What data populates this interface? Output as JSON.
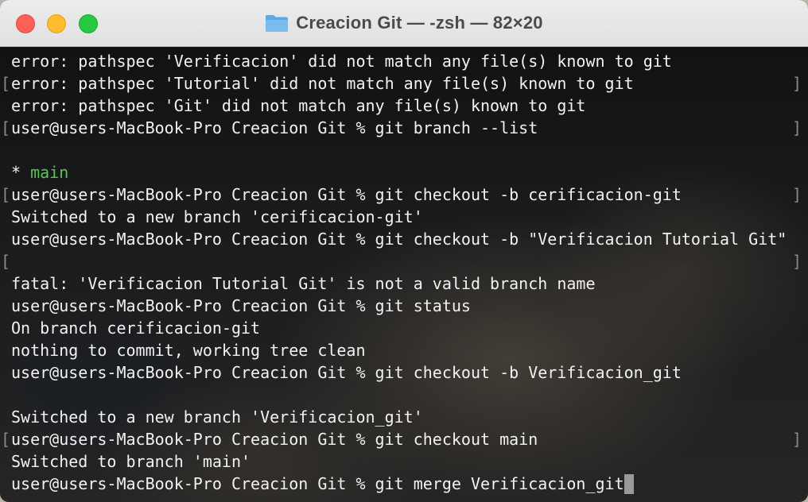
{
  "window": {
    "title": "Creacion Git — -zsh — 82×20",
    "title_icon": "folder-icon"
  },
  "terminal": {
    "lines": [
      {
        "text": "error: pathspec 'Verificacion' did not match any file(s) known to git",
        "left_bracket": "",
        "right_bracket": ""
      },
      {
        "text": "error: pathspec 'Tutorial' did not match any file(s) known to git",
        "left_bracket": "[",
        "right_bracket": "]"
      },
      {
        "text": "error: pathspec 'Git' did not match any file(s) known to git",
        "left_bracket": "",
        "right_bracket": ""
      },
      {
        "text": "user@users-MacBook-Pro Creacion Git % git branch --list",
        "left_bracket": "[",
        "right_bracket": "]"
      },
      {
        "text": "",
        "left_bracket": "",
        "right_bracket": ""
      },
      {
        "text": "",
        "star": "* ",
        "branch": "main",
        "left_bracket": "",
        "right_bracket": ""
      },
      {
        "text": "user@users-MacBook-Pro Creacion Git % git checkout -b cerificacion-git",
        "left_bracket": "[",
        "right_bracket": "]"
      },
      {
        "text": "Switched to a new branch 'cerificacion-git'",
        "left_bracket": "",
        "right_bracket": ""
      },
      {
        "text": "user@users-MacBook-Pro Creacion Git % git checkout -b \"Verificacion Tutorial Git\"",
        "left_bracket": "",
        "right_bracket": ""
      },
      {
        "text": "",
        "left_bracket": "[",
        "right_bracket": "]"
      },
      {
        "text": "fatal: 'Verificacion Tutorial Git' is not a valid branch name",
        "left_bracket": "",
        "right_bracket": ""
      },
      {
        "text": "user@users-MacBook-Pro Creacion Git % git status",
        "left_bracket": "",
        "right_bracket": ""
      },
      {
        "text": "On branch cerificacion-git",
        "left_bracket": "",
        "right_bracket": ""
      },
      {
        "text": "nothing to commit, working tree clean",
        "left_bracket": "",
        "right_bracket": ""
      },
      {
        "text": "user@users-MacBook-Pro Creacion Git % git checkout -b Verificacion_git",
        "left_bracket": "",
        "right_bracket": ""
      },
      {
        "text": "",
        "left_bracket": "",
        "right_bracket": ""
      },
      {
        "text": "Switched to a new branch 'Verificacion_git'",
        "left_bracket": "",
        "right_bracket": ""
      },
      {
        "text": "user@users-MacBook-Pro Creacion Git % git checkout main",
        "left_bracket": "[",
        "right_bracket": "]"
      },
      {
        "text": "Switched to branch 'main'",
        "left_bracket": "",
        "right_bracket": ""
      },
      {
        "text": "user@users-MacBook-Pro Creacion Git % git merge Verificacion_git",
        "left_bracket": "",
        "right_bracket": "",
        "cursor": true
      }
    ]
  },
  "colors": {
    "text": "#f2f2f2",
    "branch_highlight": "#5dc258",
    "close": "#fe5f57",
    "minimize": "#febc2e",
    "zoom": "#28c840"
  }
}
